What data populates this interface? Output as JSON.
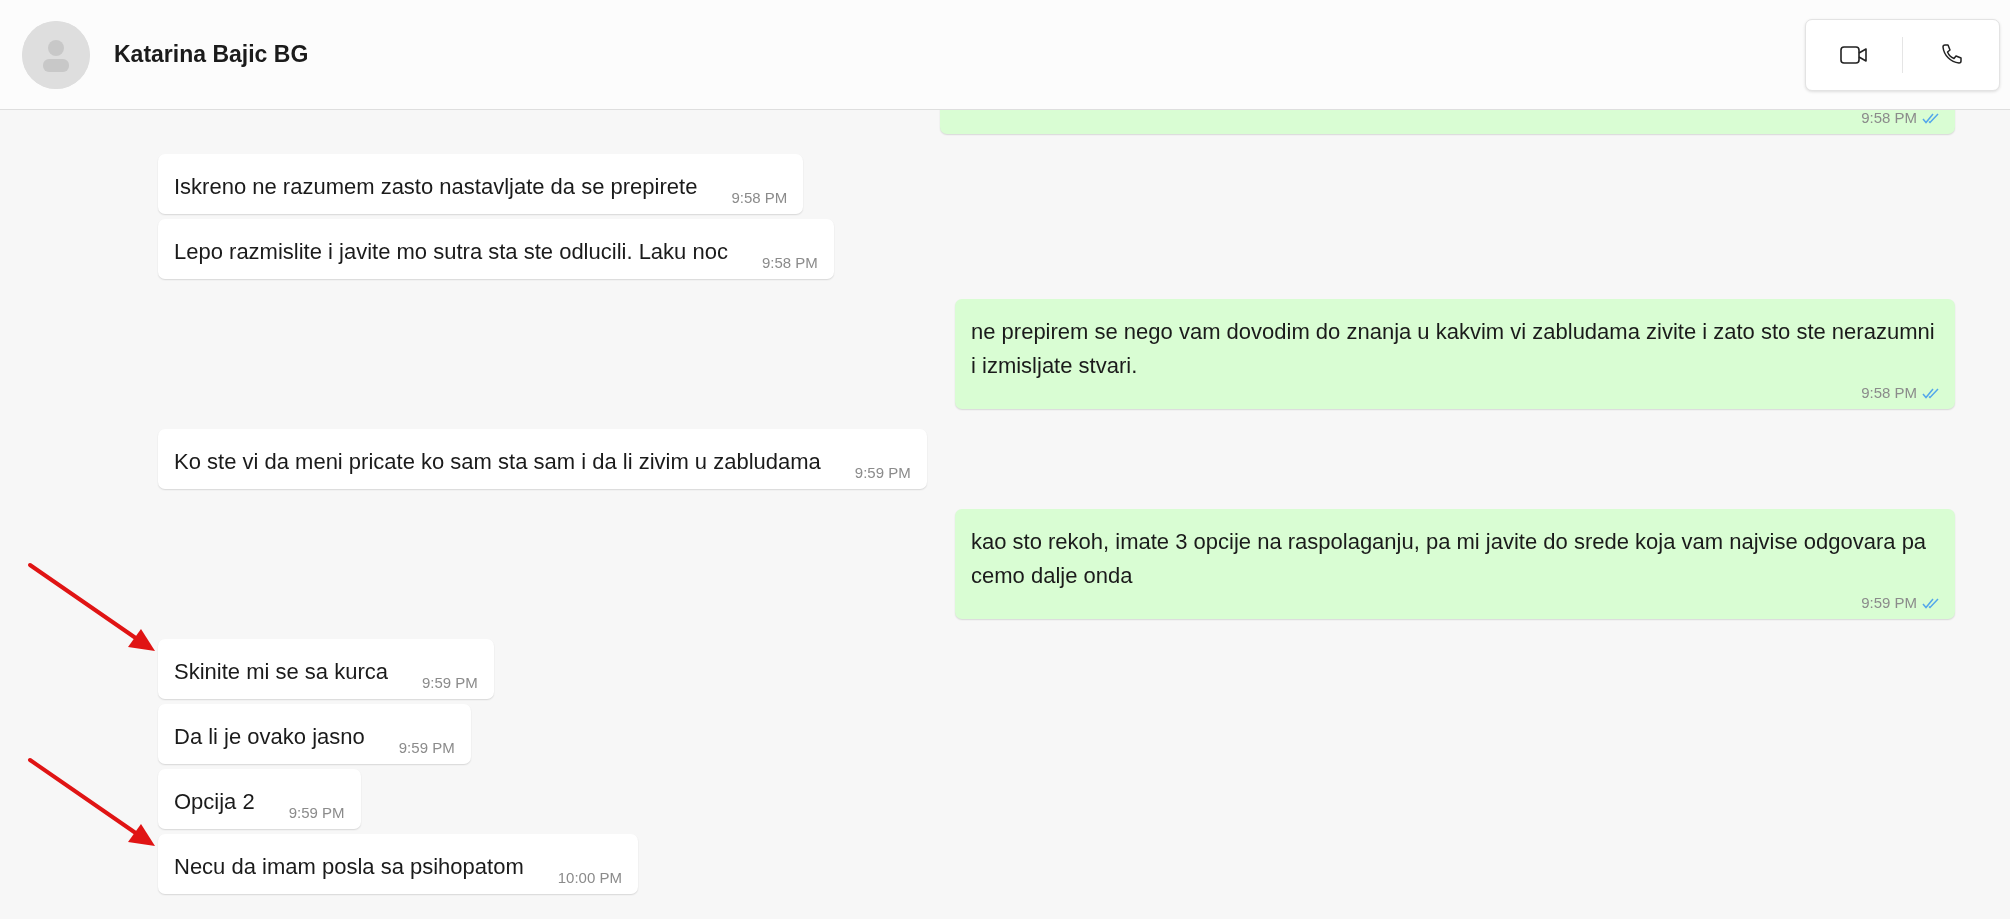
{
  "header": {
    "contact_name": "Katarina Bajic BG",
    "actions": [
      {
        "kind": "video"
      },
      {
        "kind": "voice"
      }
    ]
  },
  "messages": [
    {
      "kind": "outgoing",
      "cut_off": true,
      "marked": false,
      "time": "9:58 PM",
      "read": true
    },
    {
      "kind": "incoming",
      "cut_off": false,
      "marked": false,
      "text": "Iskreno ne razumem zasto nastavljate da se prepirete",
      "time": "9:58 PM"
    },
    {
      "kind": "incoming",
      "cut_off": false,
      "marked": false,
      "text": "Lepo razmislite i javite mo sutra sta ste odlucili. Laku noc",
      "time": "9:58 PM"
    },
    {
      "kind": "outgoing",
      "cut_off": false,
      "marked": false,
      "text": "ne prepirem se nego vam dovodim do znanja u kakvim vi zabludama zivite i zato sto ste nerazumni i izmisljate stvari.",
      "time": "9:58 PM",
      "read": true
    },
    {
      "kind": "incoming",
      "cut_off": false,
      "marked": false,
      "text": "Ko ste vi da meni pricate ko sam sta sam i da li zivim u zabludama",
      "time": "9:59 PM"
    },
    {
      "kind": "outgoing",
      "cut_off": false,
      "marked": false,
      "text": "kao sto rekoh, imate 3 opcije na raspolaganju, pa mi javite do srede koja vam najvise odgovara pa cemo dalje onda",
      "time": "9:59 PM",
      "read": true
    },
    {
      "kind": "incoming",
      "cut_off": false,
      "marked": true,
      "text": "Skinite mi se sa kurca",
      "time": "9:59 PM"
    },
    {
      "kind": "incoming",
      "cut_off": false,
      "marked": false,
      "text": "Da li je ovako jasno",
      "time": "9:59 PM"
    },
    {
      "kind": "incoming",
      "cut_off": false,
      "marked": false,
      "text": "Opcija 2",
      "time": "9:59 PM"
    },
    {
      "kind": "incoming",
      "cut_off": false,
      "marked": true,
      "text": "Necu da imam posla sa psihopatom",
      "time": "10:00 PM"
    }
  ]
}
